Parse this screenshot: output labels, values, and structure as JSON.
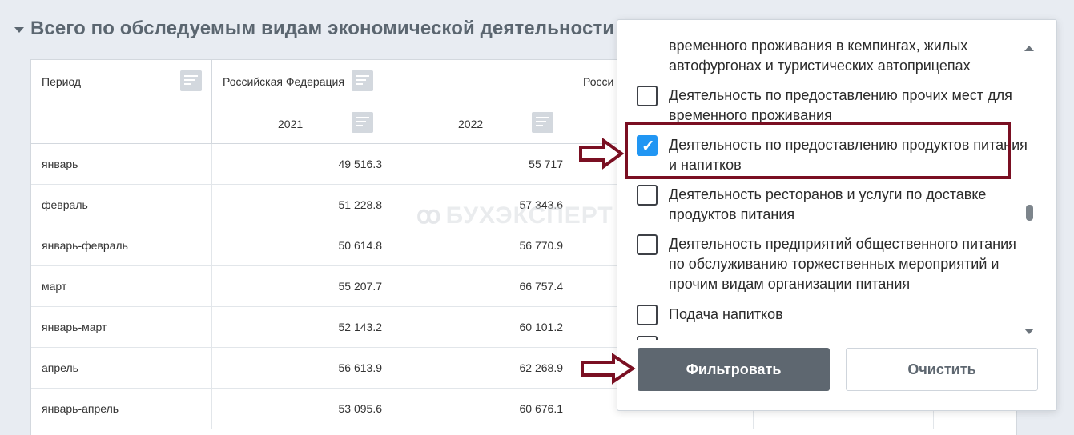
{
  "section": {
    "title": "Всего по обследуемым видам экономической деятельности"
  },
  "table": {
    "headers": {
      "period": "Период",
      "region1": "Российская Федерация",
      "region2_partial": "Росси",
      "year1": "2021",
      "year2": "2022"
    },
    "rows": [
      {
        "period": "январь",
        "v2021": "49 516.3",
        "v2022": "55 717"
      },
      {
        "period": "февраль",
        "v2021": "51 228.8",
        "v2022": "57 343.6"
      },
      {
        "period": "январь-февраль",
        "v2021": "50 614.8",
        "v2022": "56 770.9"
      },
      {
        "period": "март",
        "v2021": "55 207.7",
        "v2022": "66 757.4"
      },
      {
        "period": "январь-март",
        "v2021": "52 143.2",
        "v2022": "60 101.2"
      },
      {
        "period": "апрель",
        "v2021": "56 613.9",
        "v2022": "62 268.9"
      },
      {
        "period": "январь-апрель",
        "v2021": "53 095.6",
        "v2022": "60 676.1"
      }
    ]
  },
  "watermark": {
    "text": "БУХЭКСПЕРТ"
  },
  "filter_popup": {
    "options": [
      {
        "label": "временного проживания в кемпингах, жилых автофургонах и туристических автоприцепах",
        "checked": false
      },
      {
        "label": "Деятельность по предоставлению прочих мест для временного проживания",
        "checked": false
      },
      {
        "label": "Деятельность по предоставлению продуктов питания и напитков",
        "checked": true
      },
      {
        "label": "Деятельность ресторанов и услуги по доставке продуктов питания",
        "checked": false
      },
      {
        "label": "Деятельность предприятий общественного питания по обслуживанию торжественных мероприятий и прочим видам организации питания",
        "checked": false
      },
      {
        "label": "Подача напитков",
        "checked": false
      }
    ],
    "filter_button": "Фильтровать",
    "clear_button": "Очистить"
  },
  "colors": {
    "highlight": "#7a0f22",
    "checkbox_checked": "#2196f3",
    "button_dark": "#5e6770"
  }
}
